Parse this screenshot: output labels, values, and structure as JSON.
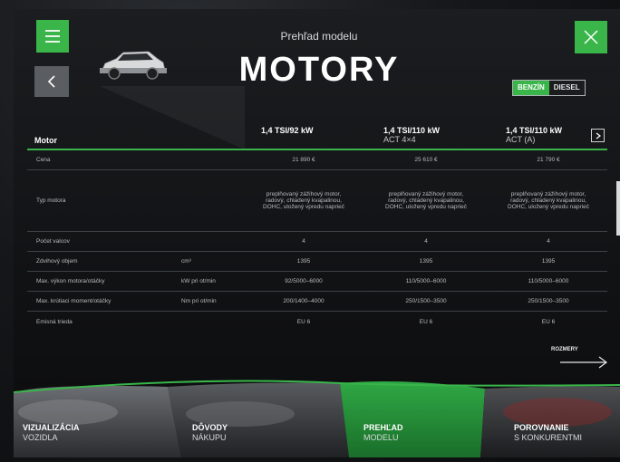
{
  "header": {
    "subtitle": "Prehľad modelu",
    "title": "MOTORY",
    "fuel": {
      "active": "BENZÍN",
      "inactive": "DIESEL"
    }
  },
  "table": {
    "head": {
      "label": "Motor",
      "col1": {
        "name": "1,4 TSI/92 kW",
        "sub": ""
      },
      "col2": {
        "name": "1,4 TSI/110 kW",
        "sub": "ACT 4×4"
      },
      "col3": {
        "name": "1,4 TSI/110 kW",
        "sub": "ACT (A)"
      }
    },
    "rows": [
      {
        "label": "Cena",
        "unit": "",
        "v1": "21 890 €",
        "v2": "25 610 €",
        "v3": "21 790 €",
        "h": 22
      },
      {
        "label": "Typ motora",
        "unit": "",
        "v1": "preplňovaný zážihový motor, radový, chladený kvapalinou, DOHC, uložený vpredu naprieč",
        "v2": "preplňovaný zážihový motor, radový, chladený kvapalinou, DOHC, uložený vpredu naprieč",
        "v3": "preplňovaný zážihový motor, radový, chladený kvapalinou, DOHC, uložený vpredu naprieč",
        "h": 68
      },
      {
        "label": "Počet valcov",
        "unit": "",
        "v1": "4",
        "v2": "4",
        "v3": "4",
        "h": 22
      },
      {
        "label": "Zdvihový objem",
        "unit": "cm³",
        "v1": "1395",
        "v2": "1395",
        "v3": "1395",
        "h": 22
      },
      {
        "label": "Max. výkon motora/otáčky",
        "unit": "kW pri ot/min",
        "v1": "92/5000–6000",
        "v2": "110/5000–6000",
        "v3": "110/5000–6000",
        "h": 22
      },
      {
        "label": "Max. krútiaci moment/otáčky",
        "unit": "Nm pri ot/min",
        "v1": "200/1400–4000",
        "v2": "250/1500–3500",
        "v3": "250/1500–3500",
        "h": 22
      },
      {
        "label": "Emisná trieda",
        "unit": "",
        "v1": "EU 6",
        "v2": "EU 6",
        "v3": "EU 6",
        "h": 22
      }
    ]
  },
  "rozmery_label": "ROZMERY",
  "nav": [
    {
      "title": "VIZUALIZÁCIA",
      "sub": "VOZIDLA"
    },
    {
      "title": "DÔVODY",
      "sub": "NÁKUPU"
    },
    {
      "title": "PREHĽAD",
      "sub": "MODELU"
    },
    {
      "title": "POROVNANIE",
      "sub": "S KONKURENTMI"
    }
  ],
  "colors": {
    "accent": "#39b54a",
    "background": "#111214"
  },
  "icons": [
    "menu-icon",
    "back-arrow-icon",
    "close-icon",
    "chevron-right-icon",
    "arrow-right-icon"
  ]
}
